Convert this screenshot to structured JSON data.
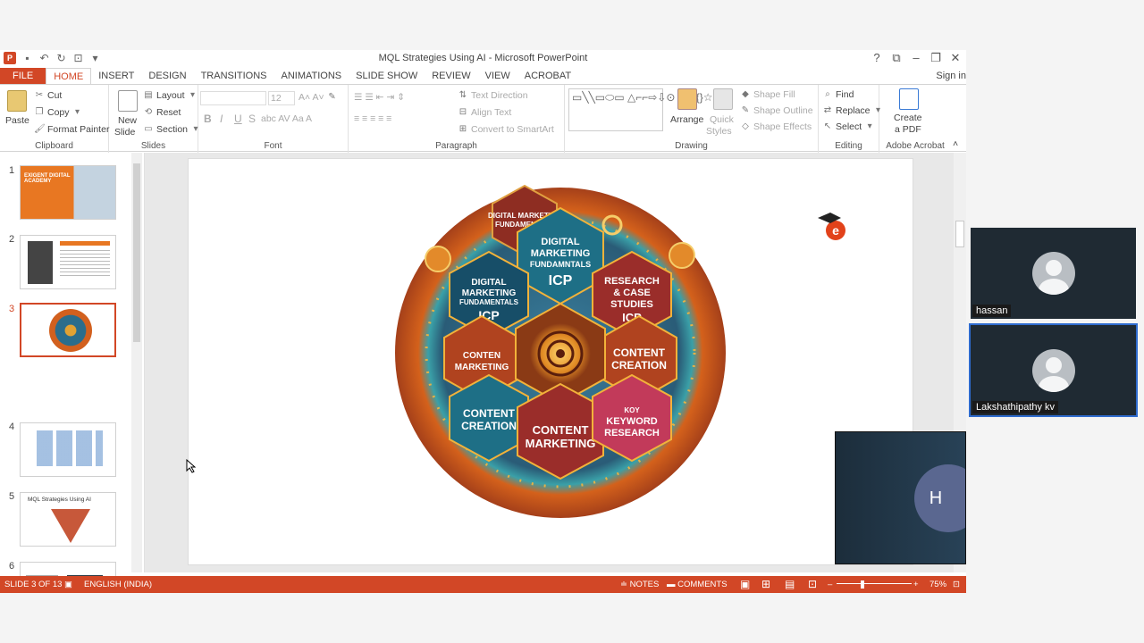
{
  "window": {
    "title": "MQL Strategies Using AI - Microsoft PowerPoint",
    "controls": [
      "?",
      "⧉",
      "–",
      "❐",
      "✕"
    ]
  },
  "tabs": [
    "FILE",
    "HOME",
    "INSERT",
    "DESIGN",
    "TRANSITIONS",
    "ANIMATIONS",
    "SLIDE SHOW",
    "REVIEW",
    "VIEW",
    "ACROBAT"
  ],
  "active_tab": "HOME",
  "signin": "Sign in",
  "ribbon": {
    "clipboard": {
      "paste": "Paste",
      "cut": "Cut",
      "copy": "Copy",
      "format_painter": "Format Painter",
      "label": "Clipboard"
    },
    "slides": {
      "new_slide_1": "New",
      "new_slide_2": "Slide",
      "layout": "Layout",
      "reset": "Reset",
      "section": "Section",
      "label": "Slides"
    },
    "font": {
      "size": "12",
      "bold": "B",
      "italic": "I",
      "underline": "U",
      "strike": "S",
      "label": "Font"
    },
    "paragraph": {
      "text_direction": "Text Direction",
      "align_text": "Align Text",
      "convert_smartart": "Convert to SmartArt",
      "label": "Paragraph"
    },
    "drawing": {
      "arrange": "Arrange",
      "quick_styles_1": "Quick",
      "quick_styles_2": "Styles",
      "shape_fill": "Shape Fill",
      "shape_outline": "Shape Outline",
      "shape_effects": "Shape Effects",
      "label": "Drawing"
    },
    "editing": {
      "find": "Find",
      "replace": "Replace",
      "select": "Select",
      "label": "Editing"
    },
    "acrobat": {
      "create_1": "Create",
      "create_2": "a PDF",
      "label": "Adobe Acrobat"
    }
  },
  "thumbnails": [
    {
      "num": "1",
      "title": "EXIGENT DIGITAL ACADEMY"
    },
    {
      "num": "2",
      "title": ""
    },
    {
      "num": "3",
      "title": ""
    },
    {
      "num": "4",
      "title": ""
    },
    {
      "num": "5",
      "title": "MQL Strategies Using AI"
    },
    {
      "num": "6",
      "title": ""
    }
  ],
  "selected_slide": 3,
  "slide": {
    "hexagons": {
      "top": "DIGITAL MARKETING FUNDAMENTALS",
      "center_top": "DIGITAL MARKETING FUNDAMENTALS ICP",
      "left_top": "DIGITAL MARKETING FUNDAMENTALS ICP",
      "right_top": "RESEARCH & CASE STUDIES ICP",
      "left_mid": "CONTEN MARKETING",
      "right_mid": "CONTENT CREATION",
      "left_bottom": "CONTENT CREATION",
      "center_bottom": "CONTENT MARKETING",
      "right_bottom": "KOY KEYWORD RESEARCH"
    }
  },
  "statusbar": {
    "slide_count": "SLIDE 3 OF 13",
    "language": "ENGLISH (INDIA)",
    "notes": "NOTES",
    "comments": "COMMENTS",
    "zoom": "75%"
  },
  "participants": [
    {
      "name": "hassan"
    },
    {
      "name": "Lakshathipathy kv"
    },
    {
      "initial": "H"
    }
  ],
  "colors": {
    "accent": "#d24726",
    "tile_bg": "#1f2a33",
    "active_speaker_border": "#2f6ccf"
  }
}
